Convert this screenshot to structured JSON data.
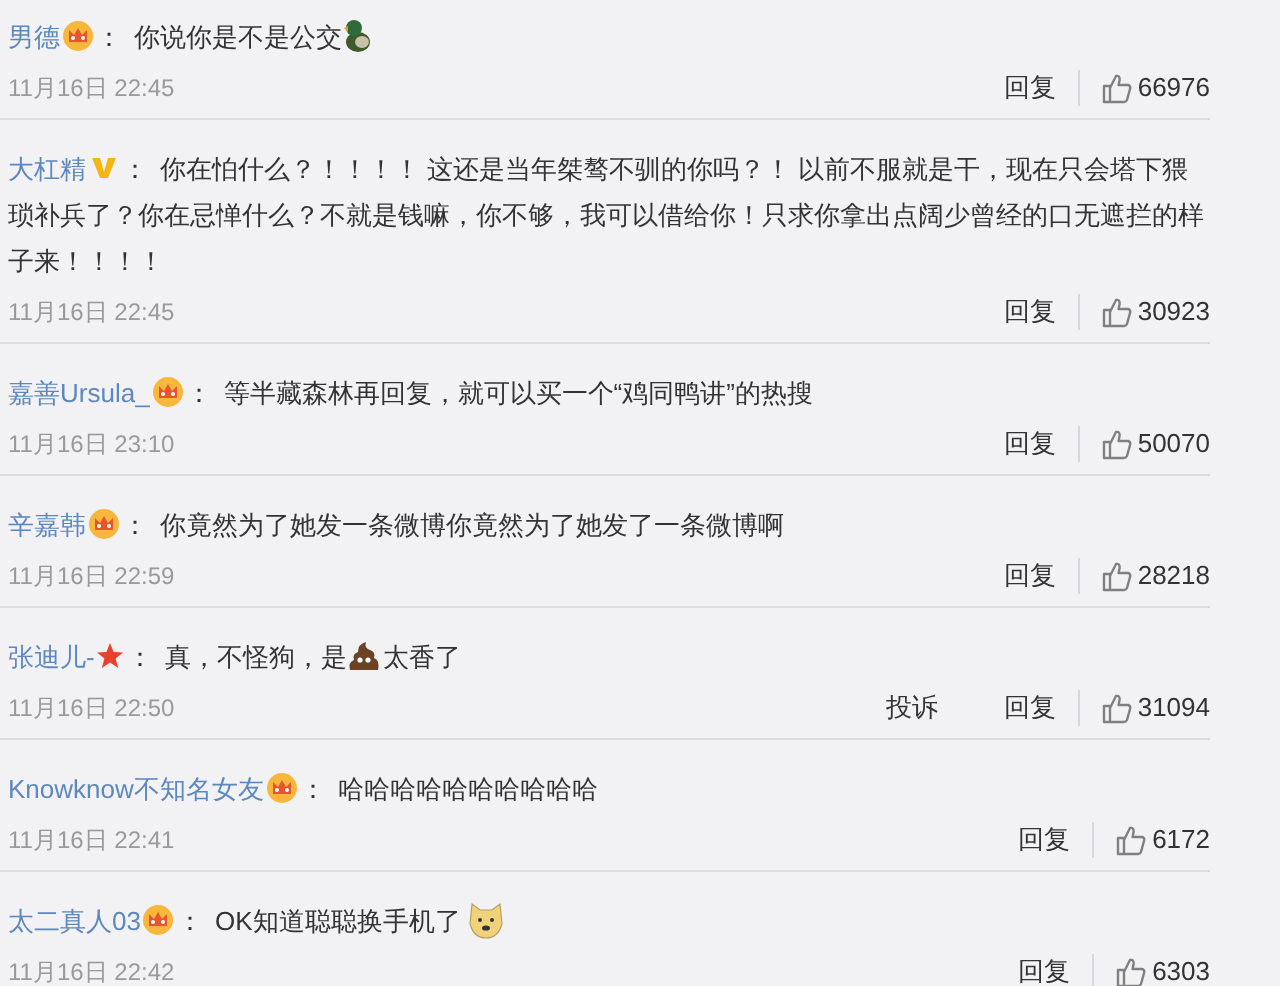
{
  "separator": "：",
  "comments": [
    {
      "user": "男德",
      "badge": {
        "kind": "crown"
      },
      "segments": [
        {
          "kind": "text",
          "text": "你说你是不是公交"
        },
        {
          "kind": "duck"
        }
      ],
      "time": "11月16日 22:45",
      "actions": [
        "回复"
      ],
      "likes": "66976"
    },
    {
      "user": "大杠精",
      "badge": {
        "kind": "v"
      },
      "segments": [
        {
          "kind": "text",
          "text": "你在怕什么？！！！！ 这还是当年桀骜不驯的你吗？！ 以前不服就是干，现在只会塔下猥琐补兵了？你在忌惮什么？不就是钱嘛，你不够，我可以借给你！只求你拿出点阔少曾经的口无遮拦的样子来！！！！"
        }
      ],
      "time": "11月16日 22:45",
      "actions": [
        "回复"
      ],
      "likes": "30923"
    },
    {
      "user": "嘉善Ursula_",
      "badge": {
        "kind": "crown"
      },
      "segments": [
        {
          "kind": "text",
          "text": "等半藏森林再回复，就可以买一个“鸡同鸭讲”的热搜"
        }
      ],
      "time": "11月16日 23:10",
      "actions": [
        "回复"
      ],
      "likes": "50070"
    },
    {
      "user": "辛嘉韩",
      "badge": {
        "kind": "crown"
      },
      "segments": [
        {
          "kind": "text",
          "text": "你竟然为了她发一条微博你竟然为了她发了一条微博啊"
        }
      ],
      "time": "11月16日 22:59",
      "actions": [
        "回复"
      ],
      "likes": "28218"
    },
    {
      "user": "张迪儿-",
      "badge": {
        "kind": "star"
      },
      "segments": [
        {
          "kind": "text",
          "text": "真，不怪狗，是"
        },
        {
          "kind": "poop"
        },
        {
          "kind": "text",
          "text": "太香了"
        }
      ],
      "time": "11月16日 22:50",
      "actions": [
        "投诉",
        "回复"
      ],
      "likes": "31094"
    },
    {
      "user": "Knowknow不知名女友",
      "badge": {
        "kind": "crown"
      },
      "segments": [
        {
          "kind": "text",
          "text": "哈哈哈哈哈哈哈哈哈哈"
        }
      ],
      "time": "11月16日 22:41",
      "actions": [
        "回复"
      ],
      "likes": "6172"
    },
    {
      "user": "太二真人03",
      "badge": {
        "kind": "crown"
      },
      "segments": [
        {
          "kind": "text",
          "text": "OK知道聪聪换手机了"
        },
        {
          "kind": "dog"
        }
      ],
      "time": "11月16日 22:42",
      "actions": [
        "回复"
      ],
      "likes": "6303"
    }
  ]
}
